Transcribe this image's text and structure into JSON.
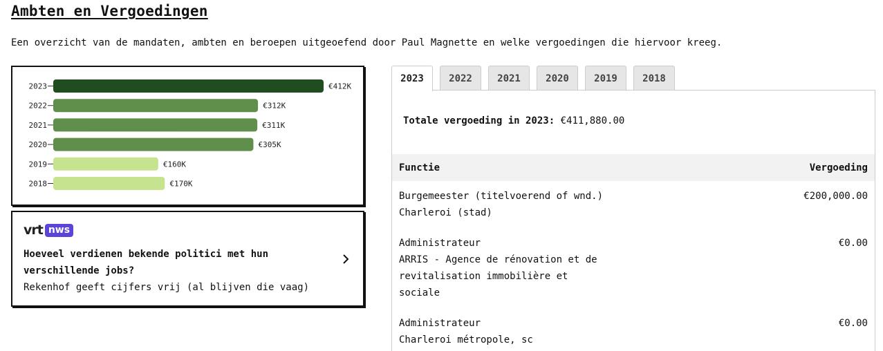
{
  "page": {
    "title": "Ambten en Vergoedingen",
    "intro": "Een overzicht van de mandaten, ambten en beroepen uitgeoefend door Paul Magnette en welke vergoedingen die hiervoor kreeg."
  },
  "chart_data": {
    "type": "bar",
    "orientation": "horizontal",
    "categories": [
      "2023",
      "2022",
      "2021",
      "2020",
      "2019",
      "2018"
    ],
    "values": [
      412,
      312,
      311,
      305,
      160,
      170
    ],
    "data_labels": [
      "€412K",
      "€312K",
      "€311K",
      "€305K",
      "€160K",
      "€170K"
    ],
    "colors": [
      "#1f4d1f",
      "#5f8f4a",
      "#5f8f4a",
      "#5f8f4a",
      "#c6e490",
      "#c6e490"
    ],
    "xlim": [
      0,
      412
    ],
    "title": "",
    "xlabel": "",
    "ylabel": "",
    "grid": false
  },
  "news": {
    "brand": "vrt",
    "badge": "nws",
    "headline": "Hoeveel verdienen bekende politici met hun verschillende jobs?",
    "subtitle": "Rekenhof geeft cijfers vrij (al blijven die vaag)",
    "icon": "chevron-right-icon"
  },
  "tabs": [
    {
      "label": "2023",
      "active": true
    },
    {
      "label": "2022",
      "active": false
    },
    {
      "label": "2021",
      "active": false
    },
    {
      "label": "2020",
      "active": false
    },
    {
      "label": "2019",
      "active": false
    },
    {
      "label": "2018",
      "active": false
    }
  ],
  "panel": {
    "total_label": "Totale vergoeding in 2023:",
    "total_value": "€411,880.00",
    "headers": {
      "function": "Functie",
      "compensation": "Vergoeding"
    },
    "rows": [
      {
        "lines": [
          "Burgemeester (titelvoerend of wnd.)",
          "Charleroi (stad)"
        ],
        "amount": "€200,000.00"
      },
      {
        "lines": [
          "Administrateur",
          "ARRIS - Agence de rénovation et de",
          "revitalisation immobilière et",
          "sociale"
        ],
        "amount": "€0.00"
      },
      {
        "lines": [
          "Administrateur",
          "Charleroi métropole, sc"
        ],
        "amount": "€0.00"
      }
    ]
  }
}
